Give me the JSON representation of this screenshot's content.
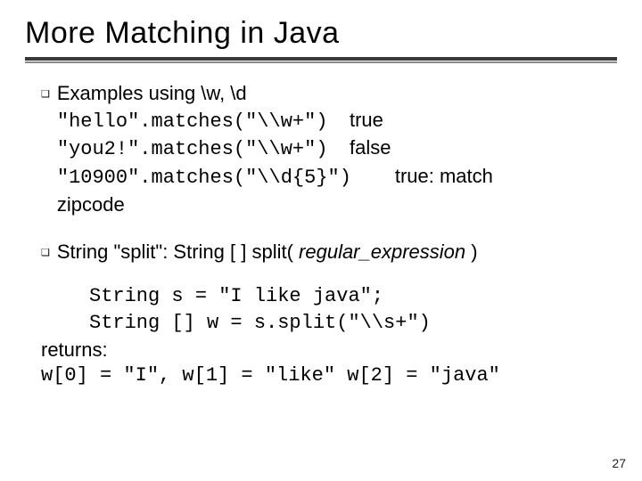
{
  "title": "More Matching in Java",
  "bullet1": {
    "lead": "Examples using \\w, \\d",
    "ex1_code": "\"hello\".matches(\"\\\\w+\")",
    "ex1_res": "true",
    "ex2_code": "\"you2!\".matches(\"\\\\w+\")",
    "ex2_res": "false",
    "ex3_code": "\"10900\".matches(\"\\\\d{5}\")",
    "ex3_res": "true: match",
    "ex3_tail": "zipcode"
  },
  "bullet2": {
    "lead_a": "String \"split\":   String [ ] split( ",
    "lead_b": "regular_expression",
    "lead_c": " )"
  },
  "bullet3": {
    "code1": "String s = \"I like    java\";",
    "code2": "String [] w = s.split(\"\\\\s+\")",
    "ret": "returns:",
    "out": "w[0] = \"I\", w[1] = \"like\" w[2] = \"java\""
  },
  "page": "27"
}
